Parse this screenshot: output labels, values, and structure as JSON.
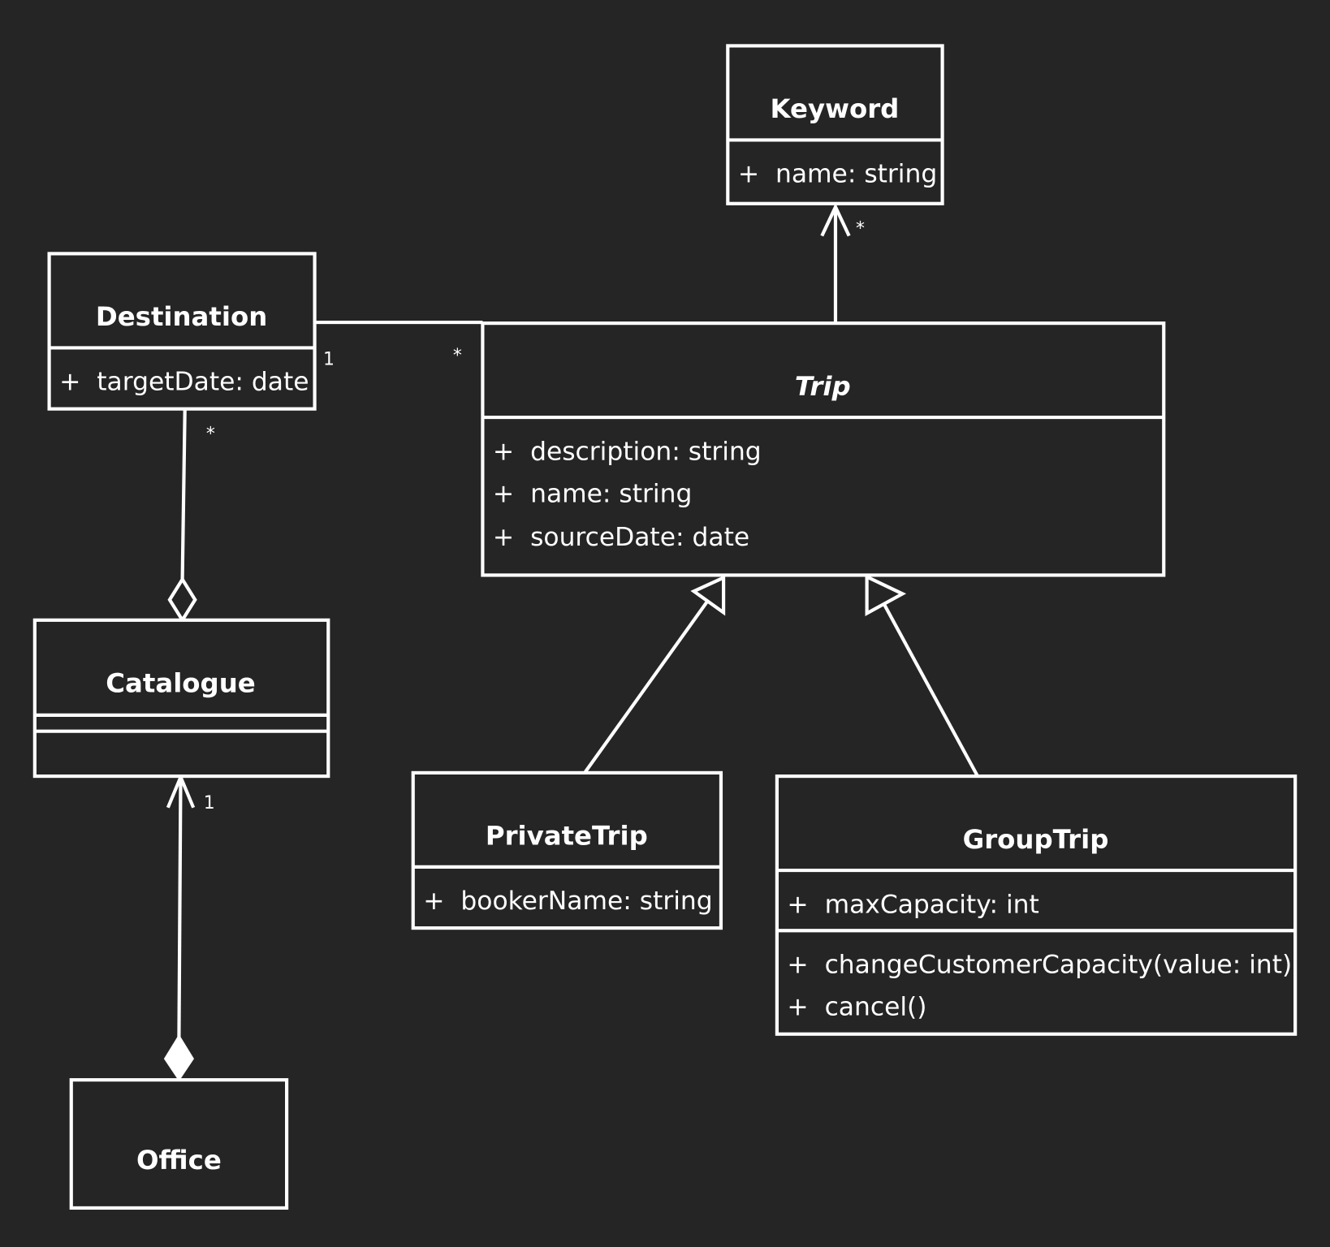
{
  "diagram": {
    "type": "UML class diagram",
    "colors": {
      "background": "#252525",
      "stroke": "#ffffff",
      "text": "#ffffff"
    },
    "classes": {
      "keyword": {
        "name": "Keyword",
        "abstract": false,
        "attributes": [
          "+  name: string"
        ],
        "operations": []
      },
      "destination": {
        "name": "Destination",
        "abstract": false,
        "attributes": [
          "+  targetDate: date"
        ],
        "operations": []
      },
      "trip": {
        "name": "Trip",
        "abstract": true,
        "attributes": [
          "+  description: string",
          "+  name: string",
          "+  sourceDate: date"
        ],
        "operations": []
      },
      "catalogue": {
        "name": "Catalogue",
        "abstract": false,
        "attributes": [],
        "operations": []
      },
      "private_trip": {
        "name": "PrivateTrip",
        "abstract": false,
        "attributes": [
          "+  bookerName: string"
        ],
        "operations": []
      },
      "group_trip": {
        "name": "GroupTrip",
        "abstract": false,
        "attributes": [
          "+  maxCapacity: int"
        ],
        "operations": [
          "+  changeCustomerCapacity(value: int)",
          "+  cancel()"
        ]
      },
      "office": {
        "name": "Office",
        "abstract": false,
        "attributes": [],
        "operations": []
      }
    },
    "relationships": [
      {
        "id": "trip-keyword",
        "kind": "directed-association",
        "from": "Trip",
        "to": "Keyword",
        "target_multiplicity": "*"
      },
      {
        "id": "destination-trip",
        "kind": "association",
        "from": "Destination",
        "to": "Trip",
        "source_multiplicity": "1",
        "target_multiplicity": "*"
      },
      {
        "id": "catalogue-destination",
        "kind": "aggregation",
        "whole": "Catalogue",
        "part": "Destination",
        "part_multiplicity": "*"
      },
      {
        "id": "office-catalogue",
        "kind": "composition",
        "whole": "Office",
        "part": "Catalogue",
        "part_multiplicity": "1"
      },
      {
        "id": "privatetrip-trip",
        "kind": "generalization",
        "child": "PrivateTrip",
        "parent": "Trip"
      },
      {
        "id": "grouptrip-trip",
        "kind": "generalization",
        "child": "GroupTrip",
        "parent": "Trip"
      }
    ],
    "multiplicity_labels": {
      "keyword_end": "*",
      "destination_end": "1",
      "trip_end": "*",
      "destination_aggregation_end": "*",
      "catalogue_composition_end": "1"
    }
  }
}
